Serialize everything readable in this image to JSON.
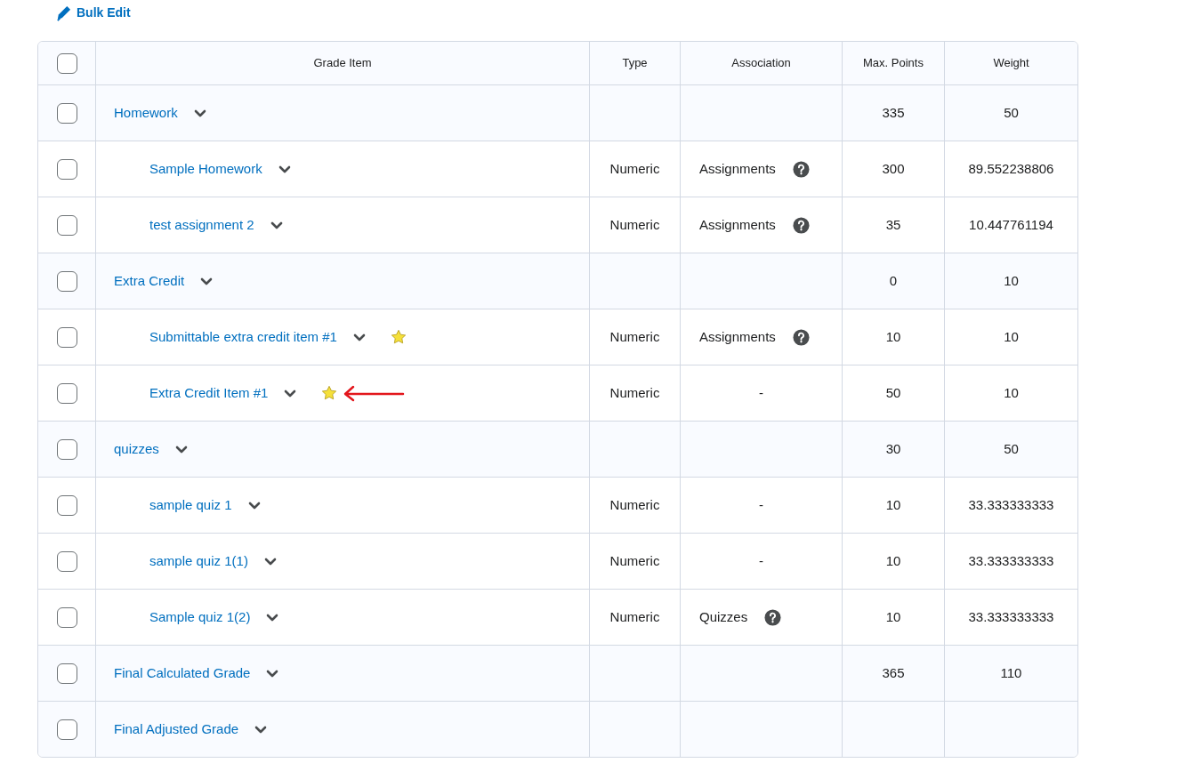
{
  "toolbar": {
    "bulk_edit": "Bulk Edit"
  },
  "table": {
    "select_all": {
      "checked": false
    },
    "columns": [
      "Grade Item",
      "Type",
      "Association",
      "Max. Points",
      "Weight"
    ],
    "rows": [
      {
        "kind": "category",
        "name": "Homework",
        "checked": false,
        "type": "",
        "association": "",
        "help": false,
        "max_points": "335",
        "weight": "50",
        "bonus": false,
        "arrow": false
      },
      {
        "kind": "item",
        "name": "Sample Homework",
        "checked": false,
        "type": "Numeric",
        "association": "Assignments",
        "help": true,
        "max_points": "300",
        "weight": "89.552238806",
        "bonus": false,
        "arrow": false
      },
      {
        "kind": "item",
        "name": "test assignment 2",
        "checked": false,
        "type": "Numeric",
        "association": "Assignments",
        "help": true,
        "max_points": "35",
        "weight": "10.447761194",
        "bonus": false,
        "arrow": false
      },
      {
        "kind": "category",
        "name": "Extra Credit",
        "checked": false,
        "type": "",
        "association": "",
        "help": false,
        "max_points": "0",
        "weight": "10",
        "bonus": false,
        "arrow": false
      },
      {
        "kind": "item",
        "name": "Submittable extra credit item #1",
        "checked": false,
        "type": "Numeric",
        "association": "Assignments",
        "help": true,
        "max_points": "10",
        "weight": "10",
        "bonus": true,
        "arrow": false
      },
      {
        "kind": "item",
        "name": "Extra Credit Item #1",
        "checked": false,
        "type": "Numeric",
        "association": "-",
        "help": false,
        "max_points": "50",
        "weight": "10",
        "bonus": true,
        "arrow": true
      },
      {
        "kind": "category",
        "name": "quizzes",
        "checked": false,
        "type": "",
        "association": "",
        "help": false,
        "max_points": "30",
        "weight": "50",
        "bonus": false,
        "arrow": false
      },
      {
        "kind": "item",
        "name": "sample quiz 1",
        "checked": false,
        "type": "Numeric",
        "association": "-",
        "help": false,
        "max_points": "10",
        "weight": "33.333333333",
        "bonus": false,
        "arrow": false
      },
      {
        "kind": "item",
        "name": "sample quiz 1(1)",
        "checked": false,
        "type": "Numeric",
        "association": "-",
        "help": false,
        "max_points": "10",
        "weight": "33.333333333",
        "bonus": false,
        "arrow": false
      },
      {
        "kind": "item",
        "name": "Sample quiz 1(2)",
        "checked": false,
        "type": "Numeric",
        "association": "Quizzes",
        "help": true,
        "max_points": "10",
        "weight": "33.333333333",
        "bonus": false,
        "arrow": false
      },
      {
        "kind": "category",
        "name": "Final Calculated Grade",
        "checked": false,
        "type": "",
        "association": "",
        "help": false,
        "max_points": "365",
        "weight": "110",
        "bonus": false,
        "arrow": false
      },
      {
        "kind": "category",
        "name": "Final Adjusted Grade",
        "checked": false,
        "type": "",
        "association": "",
        "help": false,
        "max_points": "",
        "weight": "",
        "bonus": false,
        "arrow": false
      }
    ]
  }
}
